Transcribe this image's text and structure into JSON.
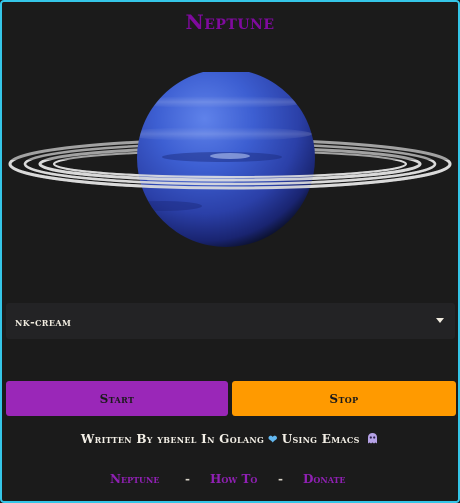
{
  "header": {
    "title": "Neptune"
  },
  "planet": {
    "image": "neptune-with-rings"
  },
  "selector": {
    "value": "nk-cream",
    "icon": "chevron-down-icon"
  },
  "controls": {
    "start_label": "Start",
    "stop_label": "Stop"
  },
  "credit": {
    "text_before": "Written By ybenel In Golang",
    "heart": "❤",
    "text_after": "Using Emacs",
    "icon": "alien-icon"
  },
  "footer": {
    "links": [
      "Neptune",
      "How To",
      "Donate"
    ],
    "separator": "-"
  },
  "colors": {
    "accent_purple": "#9a27b8",
    "accent_orange": "#ff9a00",
    "border_cyan": "#35c6e8",
    "background": "#1b1b1b"
  }
}
